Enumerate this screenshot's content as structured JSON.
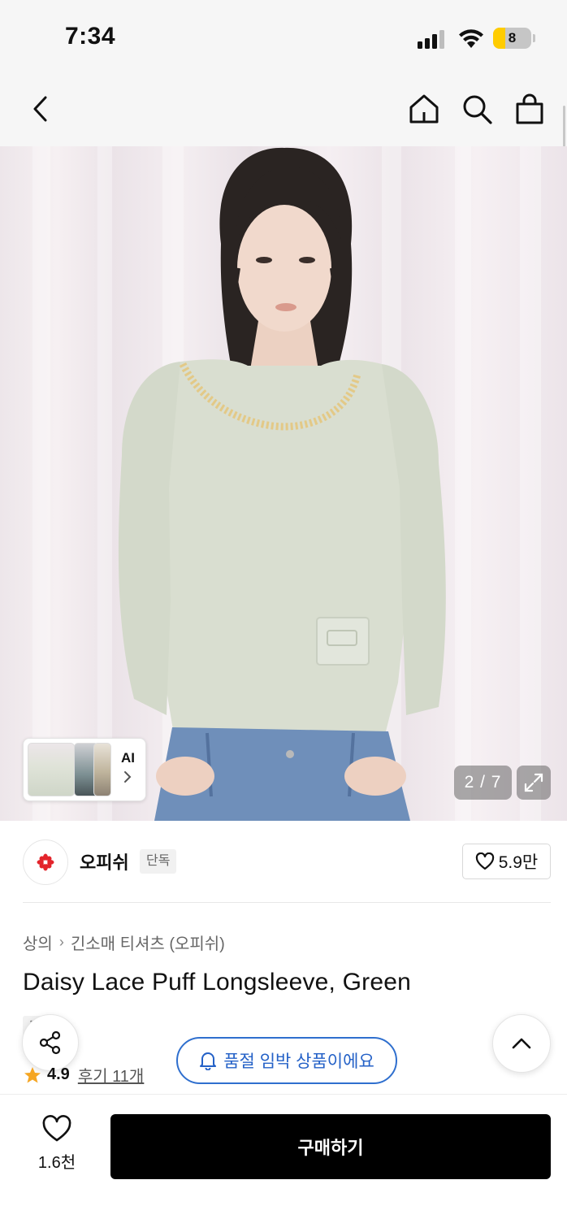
{
  "status_bar": {
    "time": "7:34",
    "battery_level": "8",
    "icons": [
      "signal-icon",
      "wifi-icon",
      "battery-icon"
    ]
  },
  "nav": {
    "icons": [
      "back-arrow-icon",
      "home-icon",
      "search-icon",
      "shopping-bag-icon"
    ]
  },
  "gallery": {
    "ai_label": "AI",
    "page_indicator": "2 / 7",
    "icons": [
      "chevron-right-icon",
      "expand-icon"
    ]
  },
  "brand": {
    "name": "오피쉬",
    "badge": "단독",
    "likes": "5.9만",
    "icons": [
      "brand-logo",
      "heart-icon"
    ]
  },
  "product": {
    "breadcrumb": [
      "상의",
      "긴소매 티셔츠 (오피쉬)"
    ],
    "title": "Daisy Lace Puff Longsleeve, Green",
    "tag": "단독",
    "rating": "4.9",
    "reviews": "후기 11개"
  },
  "restock_notice": "품절 임박 상품이에요",
  "bottom_bar": {
    "wish_count": "1.6천",
    "buy_label": "구매하기"
  },
  "colors": {
    "accent_blue": "#2461c7",
    "buy_button": "#000000",
    "star": "#f5a623",
    "brand_red": "#e3242b"
  }
}
